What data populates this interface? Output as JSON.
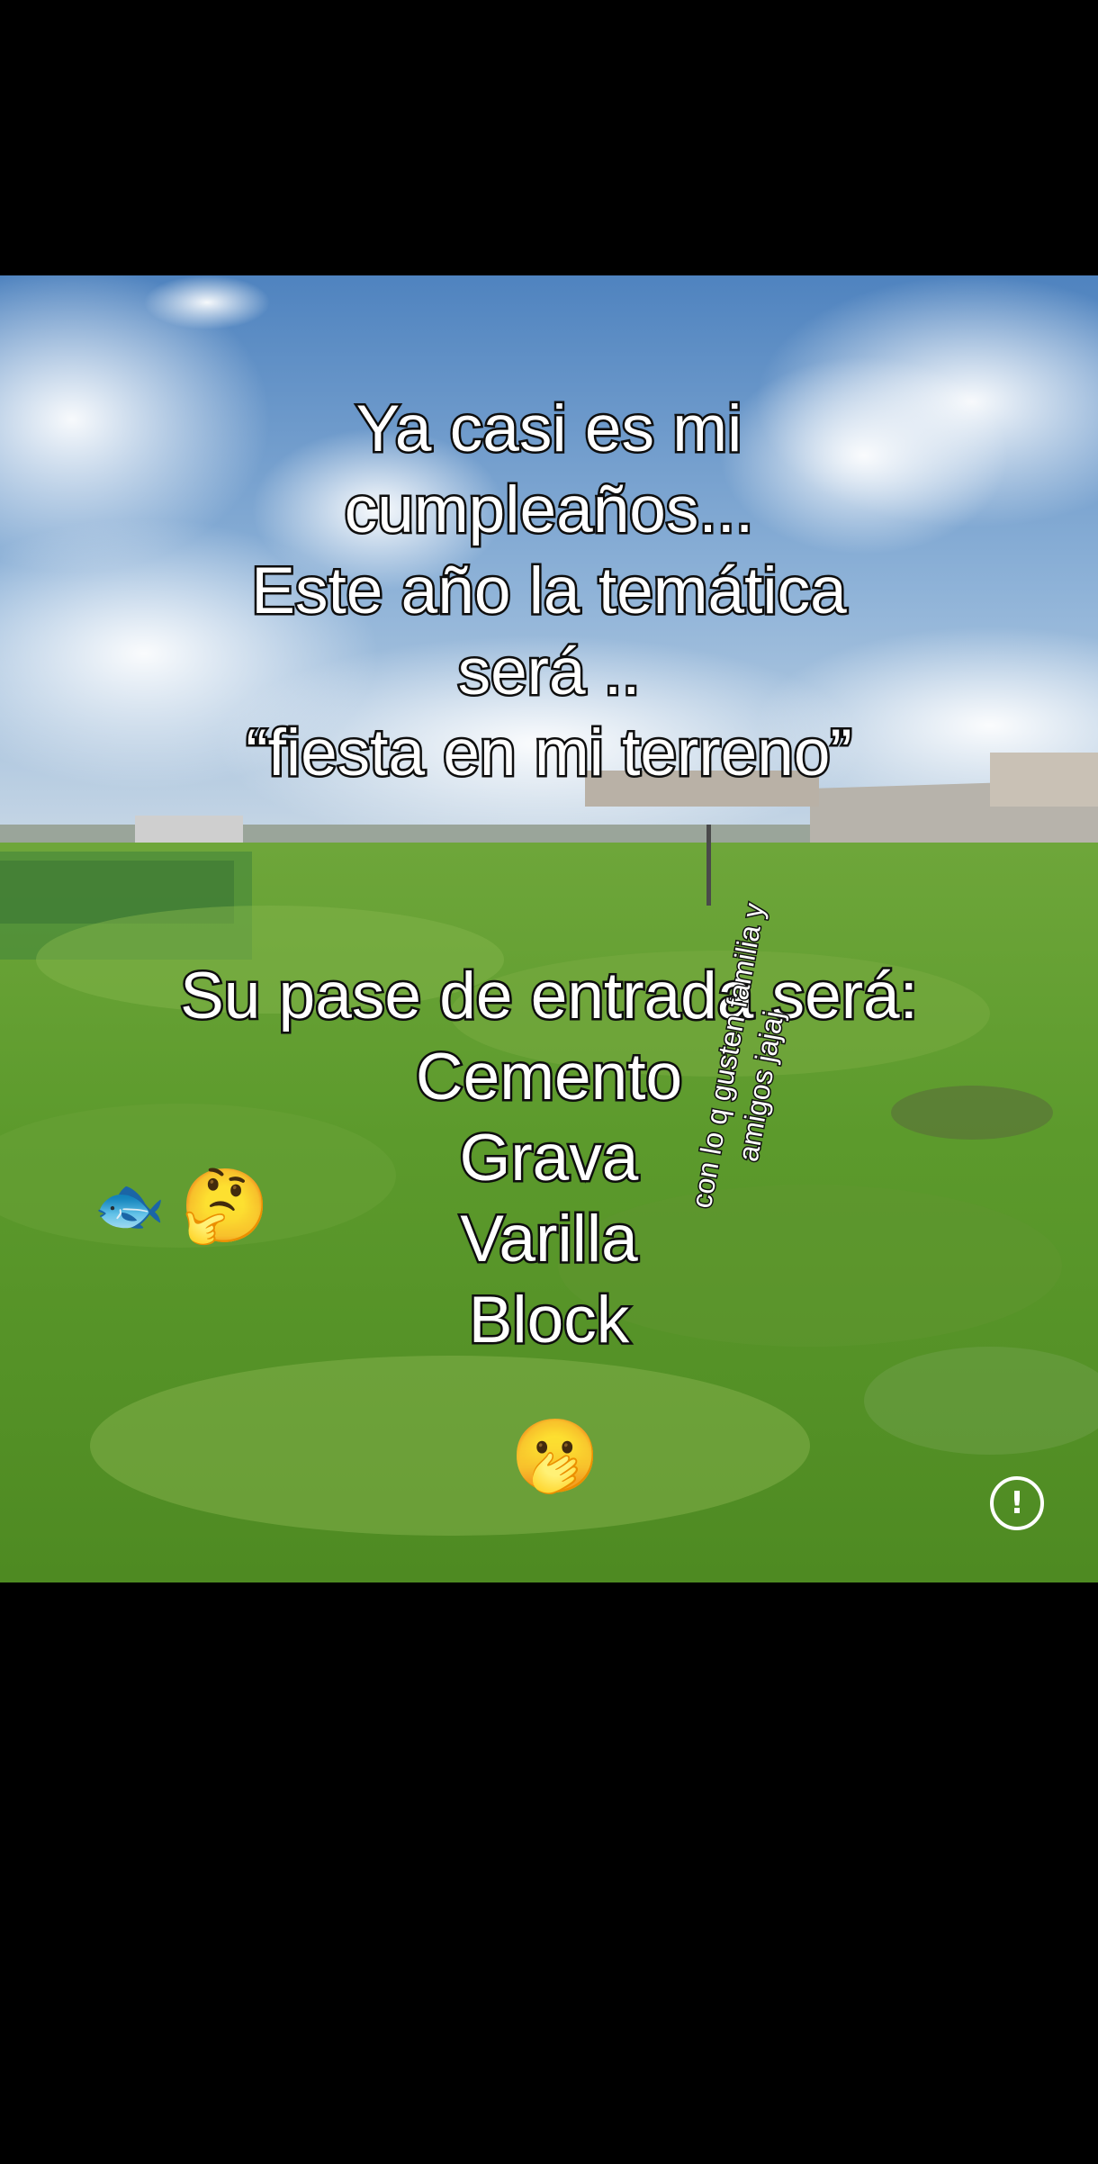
{
  "caption": {
    "line_1": "Ya casi es mi",
    "line_2": "cumpleaños...",
    "line_3": "Este año la temática",
    "line_4": "será ..",
    "line_5": "“fiesta en mi terreno”",
    "line_6": "Su pase de entrada será:",
    "line_7": "Cemento",
    "line_8": "Grava",
    "line_9": "Varilla",
    "line_10": "Block"
  },
  "side_note": {
    "line_1": "con lo q gusten  familia y",
    "line_2": "amigos jajaj"
  },
  "emojis": {
    "fish": "🐟",
    "thinking": "🤔",
    "hand_over_mouth": "🫢"
  },
  "icons": {
    "info": "!"
  },
  "colors": {
    "background": "#000000",
    "sky": "#5f8fc4",
    "grass": "#5a9a2e",
    "text": "#ffffff",
    "text_outline": "#111111"
  }
}
